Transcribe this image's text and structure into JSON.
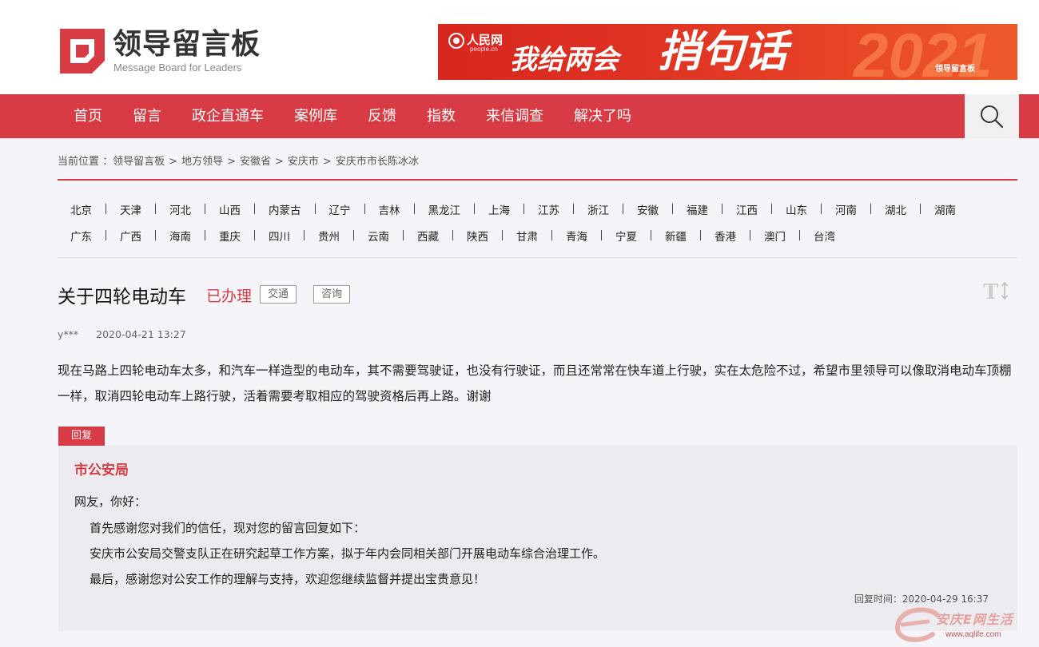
{
  "header": {
    "logo_cn": "领导留言板",
    "logo_en": "Message Board for Leaders",
    "banner": {
      "people_daily": "人民网",
      "people_daily_en": "people.cn",
      "slogan_part1": "我给两会",
      "slogan_part2": "捎句话",
      "year": "2021",
      "mini_logo": "领导留言板"
    }
  },
  "nav": {
    "items": [
      "首页",
      "留言",
      "政企直通车",
      "案例库",
      "反馈",
      "指数",
      "来信调查",
      "解决了吗"
    ],
    "search_icon": "search-icon"
  },
  "breadcrumb": {
    "prefix": "当前位置 ：",
    "items": [
      "领导留言板",
      "地方领导",
      "安徽省",
      "安庆市",
      "安庆市市长陈冰冰"
    ],
    "separator": ">"
  },
  "regions": {
    "row1": [
      "北京",
      "天津",
      "河北",
      "山西",
      "内蒙古",
      "辽宁",
      "吉林",
      "黑龙江",
      "上海",
      "江苏",
      "浙江",
      "安徽",
      "福建",
      "江西",
      "山东",
      "河南",
      "湖北",
      "湖南"
    ],
    "row2": [
      "广东",
      "广西",
      "海南",
      "重庆",
      "四川",
      "贵州",
      "云南",
      "西藏",
      "陕西",
      "甘肃",
      "青海",
      "宁夏",
      "新疆",
      "香港",
      "澳门",
      "台湾"
    ]
  },
  "message": {
    "title": "关于四轮电动车",
    "status": "已办理",
    "tags": [
      "交通",
      "咨询"
    ],
    "font_size_icon": "font-size-icon",
    "author": "y***",
    "date": "2020-04-21 13:27",
    "content": "现在马路上四轮电动车太多，和汽车一样造型的电动车，其不需要驾驶证，也没有行驶证，而且还常常在快车道上行驶，实在太危险不过，希望市里领导可以像取消电动车顶棚一样，取消四轮电动车上路行驶，活着需要考取相应的驾驶资格后再上路。谢谢"
  },
  "reply": {
    "tab_label": "回复",
    "department": "市公安局",
    "greeting": "网友，你好：",
    "lines": [
      "首先感谢您对我们的信任，现对您的留言回复如下：",
      "安庆市公安局交警支队正在研究起草工作方案，拟于年内会同相关部门开展电动车综合治理工作。",
      "最后，感谢您对公安工作的理解与支持，欢迎您继续监督并提出宝贵意见！"
    ],
    "time_label": "回复时间：",
    "time_value": "2020-04-29 16:37"
  },
  "watermark": {
    "text": "安庆E网生活",
    "url": "www.aqlife.com"
  },
  "colors": {
    "brand_red": "#d83b43",
    "banner_red": "#d7261e",
    "reply_bg": "#ebebf0"
  }
}
